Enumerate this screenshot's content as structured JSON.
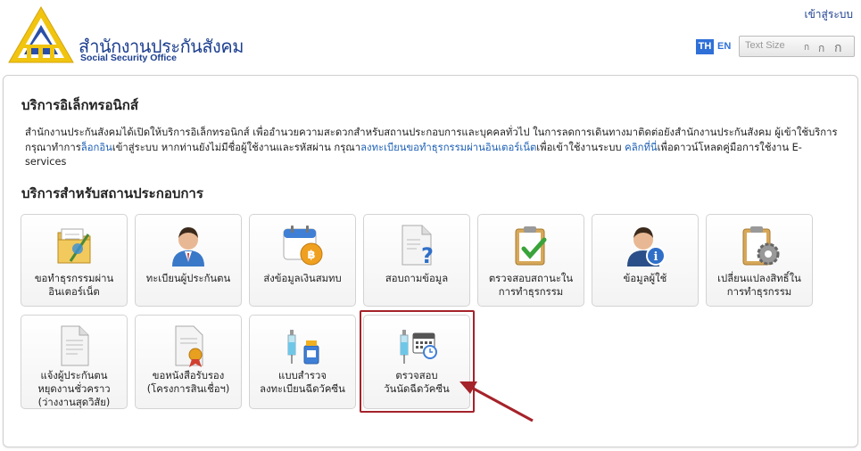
{
  "header": {
    "org_name_th": "สำนักงานประกันสังคม",
    "org_name_en": "Social Security Office",
    "login_link": "เข้าสู่ระบบ",
    "lang_th": "TH",
    "lang_en": "EN",
    "text_size_label": "Text Size",
    "size_small": "ก",
    "size_medium": "ก",
    "size_large": "ก"
  },
  "eservices": {
    "title": "บริการอิเล็กทรอนิกส์",
    "desc_1": "สำนักงานประกันสังคมได้เปิดให้บริการอิเล็กทรอนิกส์ เพื่ออำนวยความสะดวกสำหรับสถานประกอบการและบุคคลทั่วไป ในการลดการเดินทางมาติดต่อยังสำนักงานประกันสังคม ผู้เข้าใช้บริการ กรุณาทำการ",
    "link_login": "ล็อกอิน",
    "desc_2": "เข้าสู่ระบบ หากท่านยังไม่มีชื่อผู้ใช้งานและรหัสผ่าน กรุณา",
    "link_register": "ลงทะเบียนขอทำธุรกรรมผ่านอินเตอร์เน็ต",
    "desc_3": "เพื่อเข้าใช้งานระบบ ",
    "link_click": "คลิกที่นี่",
    "desc_4": "เพื่อดาวน์โหลดคู่มือการใช้งาน E-services"
  },
  "employer_services": {
    "title": "บริการสำหรับสถานประกอบการ",
    "tiles": [
      {
        "label_1": "ขอทำธุรกรรมผ่าน",
        "label_2": "อินเตอร์เน็ต",
        "icon": "folder-pen-icon"
      },
      {
        "label_1": "ทะเบียนผู้ประกันตน",
        "label_2": "",
        "icon": "person-icon"
      },
      {
        "label_1": "ส่งข้อมูลเงินสมทบ",
        "label_2": "",
        "icon": "calendar-baht-icon"
      },
      {
        "label_1": "สอบถามข้อมูล",
        "label_2": "",
        "icon": "document-question-icon"
      },
      {
        "label_1": "ตรวจสอบสถานะใน",
        "label_2": "การทำธุรกรรม",
        "icon": "clipboard-check-icon"
      },
      {
        "label_1": "ข้อมูลผู้ใช้",
        "label_2": "",
        "icon": "user-info-icon"
      },
      {
        "label_1": "เปลี่ยนแปลงสิทธิ์ใน",
        "label_2": "การทำธุรกรรม",
        "icon": "clipboard-gear-icon"
      },
      {
        "label_1": "แจ้งผู้ประกันตน",
        "label_2": "หยุดงานชั่วคราว",
        "label_3": "(ว่างงานสุดวิสัย)",
        "icon": "document-icon"
      },
      {
        "label_1": "ขอหนังสือรับรอง",
        "label_2": "(โครงการสินเชื่อฯ)",
        "icon": "certificate-icon"
      },
      {
        "label_1": "แบบสำรวจ",
        "label_2": "ลงทะเบียนฉีดวัคซีน",
        "icon": "vaccine-vial-icon"
      },
      {
        "label_1": "ตรวจสอบ",
        "label_2": "วันนัดฉีดวัคซีน",
        "icon": "vaccine-calendar-icon"
      }
    ]
  },
  "colors": {
    "brand_blue": "#1d3f8f",
    "link_blue": "#1d5fb5",
    "highlight_red": "#a5232a"
  }
}
